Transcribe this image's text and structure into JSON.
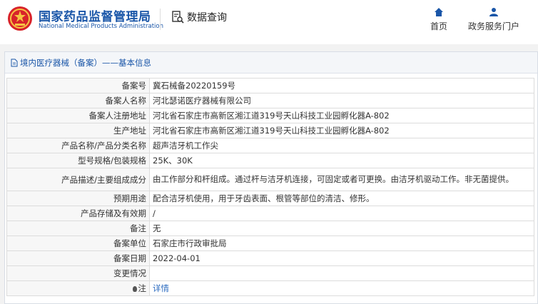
{
  "header": {
    "org_name": "国家药品监督管理局",
    "org_name_en": "National Medical Products Administration",
    "data_query": "数据查询",
    "nav": [
      {
        "label": "首页",
        "icon": "home-icon"
      },
      {
        "label": "政务服务门户",
        "icon": "user-icon"
      }
    ]
  },
  "section": {
    "title": "境内医疗器械（备案）——基本信息"
  },
  "rows": [
    {
      "label": "备案号",
      "value": "冀石械备20220159号"
    },
    {
      "label": "备案人名称",
      "value": "河北瑟诺医疗器械有限公司"
    },
    {
      "label": "备案人注册地址",
      "value": "河北省石家庄市高新区湘江道319号天山科技工业园孵化器A-802"
    },
    {
      "label": "生产地址",
      "value": "河北省石家庄市高新区湘江道319号天山科技工业园孵化器A-802"
    },
    {
      "label": "产品名称/产品分类名称",
      "value": "超声洁牙机工作尖"
    },
    {
      "label": "型号规格/包装规格",
      "value": "25K、30K"
    },
    {
      "label": "产品描述/主要组成成分",
      "value": "由工作部分和杆组成。通过杆与洁牙机连接，可固定或者可更换。由洁牙机驱动工作。非无菌提供。"
    },
    {
      "label": "预期用途",
      "value": "配合洁牙机使用，用于牙齿表面、根管等部位的清洁、修形。"
    },
    {
      "label": "产品存储及有效期",
      "value": "/"
    },
    {
      "label": "备注",
      "value": "无"
    },
    {
      "label": "备案单位",
      "value": "石家庄市行政审批局"
    },
    {
      "label": "备案日期",
      "value": "2022-04-01"
    },
    {
      "label": "变更情况",
      "value": ""
    },
    {
      "label": "注",
      "value": "详情"
    }
  ],
  "colors": {
    "brand": "#1a56a8",
    "link": "#2d6cc0"
  }
}
